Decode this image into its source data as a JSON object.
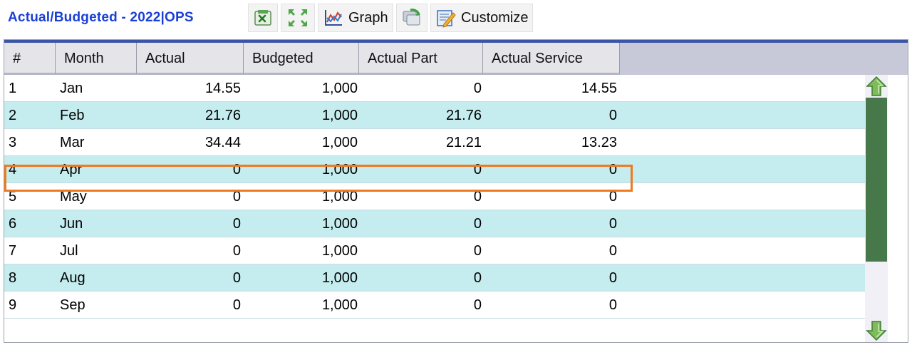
{
  "app": {
    "title": "Actual/Budgeted - 2022|OPS"
  },
  "toolbar": {
    "graph_label": "Graph",
    "customize_label": "Customize"
  },
  "table": {
    "columns": [
      "#",
      "Month",
      "Actual",
      "Budgeted",
      "Actual Part",
      "Actual Service"
    ],
    "rows": [
      {
        "num": "1",
        "month": "Jan",
        "actual": "14.55",
        "budgeted": "1,000",
        "part": "0",
        "service": "14.55"
      },
      {
        "num": "2",
        "month": "Feb",
        "actual": "21.76",
        "budgeted": "1,000",
        "part": "21.76",
        "service": "0"
      },
      {
        "num": "3",
        "month": "Mar",
        "actual": "34.44",
        "budgeted": "1,000",
        "part": "21.21",
        "service": "13.23"
      },
      {
        "num": "4",
        "month": "Apr",
        "actual": "0",
        "budgeted": "1,000",
        "part": "0",
        "service": "0"
      },
      {
        "num": "5",
        "month": "May",
        "actual": "0",
        "budgeted": "1,000",
        "part": "0",
        "service": "0"
      },
      {
        "num": "6",
        "month": "Jun",
        "actual": "0",
        "budgeted": "1,000",
        "part": "0",
        "service": "0"
      },
      {
        "num": "7",
        "month": "Jul",
        "actual": "0",
        "budgeted": "1,000",
        "part": "0",
        "service": "0"
      },
      {
        "num": "8",
        "month": "Aug",
        "actual": "0",
        "budgeted": "1,000",
        "part": "0",
        "service": "0"
      },
      {
        "num": "9",
        "month": "Sep",
        "actual": "0",
        "budgeted": "1,000",
        "part": "0",
        "service": "0"
      }
    ],
    "highlighted_row": "3"
  },
  "icons": {
    "export": "excel-export-icon",
    "expand": "expand-icon",
    "graph": "graph-icon",
    "refresh": "refresh-icon",
    "customize": "customize-icon",
    "scroll_up": "scroll-up-arrow-icon",
    "scroll_down": "scroll-down-arrow-icon"
  },
  "colors": {
    "title": "#1a3fd6",
    "header_bg": "#e4e4e9",
    "alt_row": "#c5ecee",
    "highlight_border": "#ee7a1f",
    "scroll_thumb": "#46784a"
  }
}
